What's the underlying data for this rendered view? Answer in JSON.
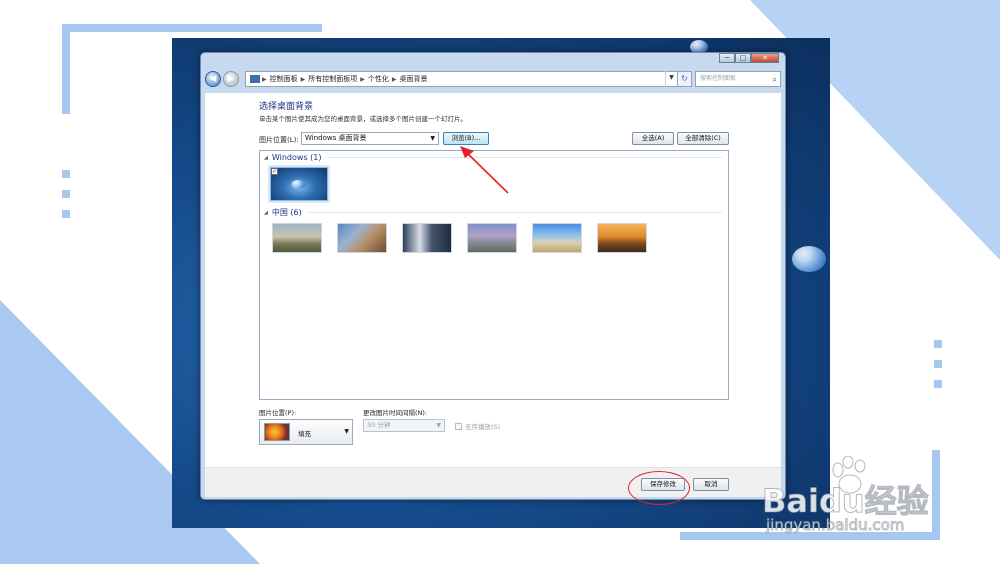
{
  "window": {
    "title_buttons": [
      "─",
      "□",
      "✕"
    ],
    "breadcrumbs": [
      "控制面板",
      "所有控制面板项",
      "个性化",
      "桌面背景"
    ],
    "search_placeholder": "搜索控制面板"
  },
  "page": {
    "heading": "选择桌面背景",
    "subtext": "单击某个图片使其成为您的桌面背景，或选择多个图片创建一个幻灯片。",
    "location_label": "图片位置(L):",
    "location_value": "Windows 桌面背景",
    "browse_label": "浏览(B)...",
    "select_all_label": "全选(A)",
    "clear_all_label": "全部清除(C)"
  },
  "gallery": {
    "groups": [
      {
        "name": "Windows (1)",
        "count": 1
      },
      {
        "name": "中国 (6)",
        "count": 6
      }
    ],
    "selected_thumb": "windows-wallpaper",
    "checkmark": "✓"
  },
  "options": {
    "position_label": "图片位置(P):",
    "position_value": "填充",
    "interval_label": "更改图片时间间隔(N):",
    "interval_value": "30 分钟",
    "shuffle_label": "无序播放(S)"
  },
  "footer": {
    "save_label": "保存修改",
    "cancel_label": "取消"
  },
  "watermark": {
    "brand": "Baidu经验",
    "url": "jingyan.baidu.com"
  },
  "colors": {
    "accent_blue": "#1e3287",
    "annotation_red": "#e3222b",
    "deco_blue": "#a6c7f0"
  }
}
